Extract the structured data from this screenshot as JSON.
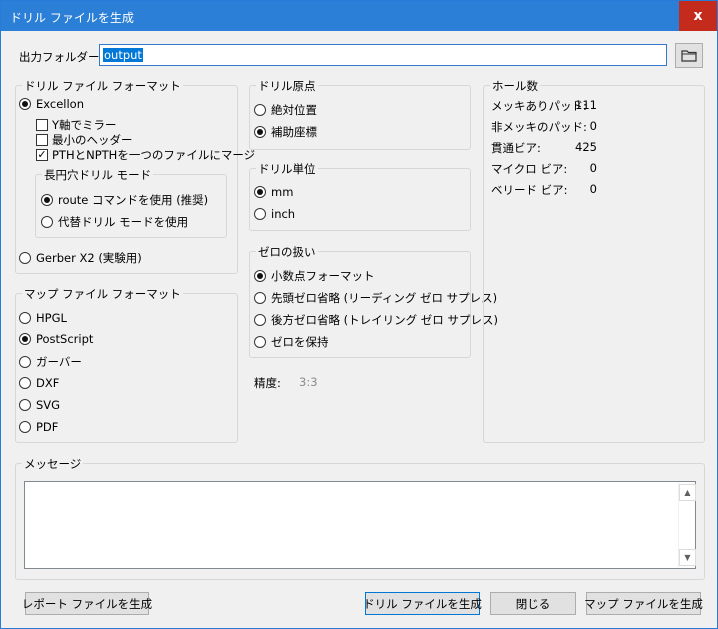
{
  "window": {
    "title": "ドリル ファイルを生成",
    "close_glyph": "x"
  },
  "output_folder": {
    "label": "出力フォルダー:",
    "value": "output"
  },
  "drill_format": {
    "title": "ドリル ファイル フォーマット",
    "excellon": "Excellon",
    "mirror_y": "Y軸でミラー",
    "min_header": "最小のヘッダー",
    "merge_pth": "PTHとNPTHを一つのファイルにマージ",
    "oval": {
      "title": "長円穴ドリル モード",
      "route": "route コマンドを使用 (推奨)",
      "alternate": "代替ドリル モードを使用"
    },
    "gerber": "Gerber X2 (実験用)"
  },
  "map_format": {
    "title": "マップ ファイル フォーマット",
    "options": [
      "HPGL",
      "PostScript",
      "ガーバー",
      "DXF",
      "SVG",
      "PDF"
    ]
  },
  "origin": {
    "title": "ドリル原点",
    "absolute": "絶対位置",
    "aux": "補助座標"
  },
  "units": {
    "title": "ドリル単位",
    "mm": "mm",
    "inch": "inch"
  },
  "zeros": {
    "title": "ゼロの扱い",
    "decimal": "小数点フォーマット",
    "suppress_leading": "先頭ゼロ省略 (リーディング ゼロ サプレス)",
    "suppress_trailing": "後方ゼロ省略 (トレイリング ゼロ サプレス)",
    "keep": "ゼロを保持"
  },
  "precision": {
    "label": "精度:",
    "value": "3:3"
  },
  "holes": {
    "title": "ホール数",
    "plated_label": "メッキありパッド:",
    "plated": "111",
    "nonplated_label": "非メッキのパッド:",
    "nonplated": "0",
    "through_label": "貫通ビア:",
    "through": "425",
    "micro_label": "マイクロ ビア:",
    "micro": "0",
    "buried_label": "ベリード ビア:",
    "buried": "0"
  },
  "messages": {
    "title": "メッセージ"
  },
  "buttons": {
    "report": "レポート ファイルを生成",
    "generate": "ドリル ファイルを生成",
    "close": "閉じる",
    "map": "マップ ファイルを生成"
  }
}
